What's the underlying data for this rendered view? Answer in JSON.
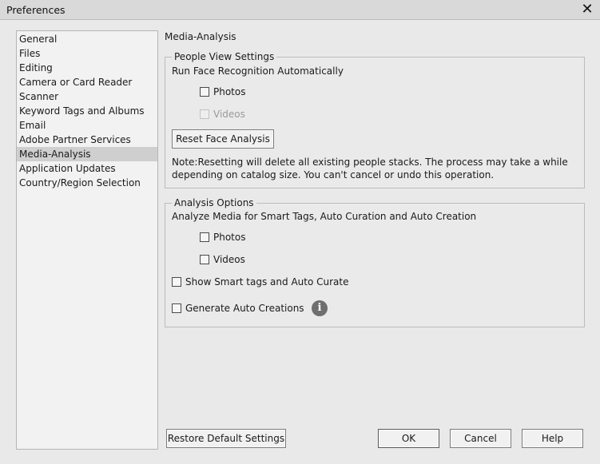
{
  "window": {
    "title": "Preferences",
    "close_glyph": "✕"
  },
  "sidebar": {
    "items": [
      {
        "label": "General"
      },
      {
        "label": "Files"
      },
      {
        "label": "Editing"
      },
      {
        "label": "Camera or Card Reader"
      },
      {
        "label": "Scanner"
      },
      {
        "label": "Keyword Tags and Albums"
      },
      {
        "label": "Email"
      },
      {
        "label": "Adobe Partner Services"
      },
      {
        "label": "Media-Analysis",
        "selected": true
      },
      {
        "label": "Application Updates"
      },
      {
        "label": "Country/Region Selection"
      }
    ]
  },
  "main": {
    "section_title": "Media-Analysis",
    "people_view": {
      "legend": "People View Settings",
      "heading": "Run Face Recognition Automatically",
      "photos_label": "Photos",
      "photos_checked": false,
      "videos_label": "Videos",
      "videos_checked": false,
      "videos_disabled": true,
      "reset_button": "Reset Face Analysis",
      "note_line1": "Note:Resetting will delete all existing people stacks. The process may take a while",
      "note_line2": "depending on catalog size. You can't cancel or undo this operation."
    },
    "analysis": {
      "legend": "Analysis Options",
      "heading": "Analyze Media for Smart Tags, Auto Curation and Auto Creation",
      "photos_label": "Photos",
      "photos_checked": false,
      "videos_label": "Videos",
      "videos_checked": false,
      "smart_tags_label": "Show Smart tags and Auto Curate",
      "smart_tags_checked": false,
      "auto_creations_label": "Generate Auto Creations",
      "auto_creations_checked": false,
      "info_glyph": "i",
      "info_icon": "info-icon"
    }
  },
  "footer": {
    "restore_button": "Restore Default Settings",
    "ok_button": "OK",
    "cancel_button": "Cancel",
    "help_button": "Help"
  }
}
